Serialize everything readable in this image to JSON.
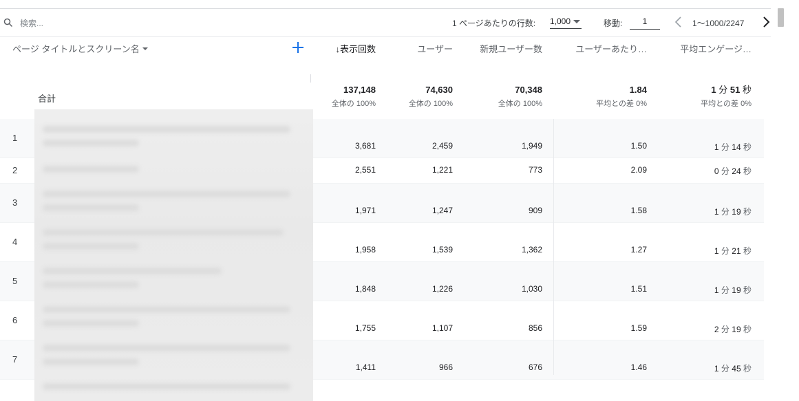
{
  "toolbar": {
    "search_placeholder": "検索...",
    "rows_per_page_label": "1 ページあたりの行数:",
    "rows_per_page_value": "1,000",
    "goto_label": "移動:",
    "goto_value": "1",
    "range": "1〜1000/2247"
  },
  "header": {
    "dimension": "ページ タイトルとスクリーン名",
    "metrics": [
      "↓表示回数",
      "ユーザー",
      "新規ユーザー数",
      "ユーザーあたり…",
      "平均エンゲージ…"
    ]
  },
  "totals": {
    "label": "合計",
    "views": "137,148",
    "views_sub": "全体の 100%",
    "users": "74,630",
    "users_sub": "全体の 100%",
    "new_users": "70,348",
    "new_users_sub": "全体の 100%",
    "per_user": "1.84",
    "per_user_sub": "平均との差 0%",
    "eng_min": "1",
    "eng_sec": "51",
    "min_unit": "分",
    "sec_unit": "秒",
    "eng_sub": "平均との差 0%"
  },
  "rows": [
    {
      "n": "1",
      "views": "3,681",
      "users": "2,459",
      "new_users": "1,949",
      "per_user": "1.50",
      "min": "1",
      "sec": "14"
    },
    {
      "n": "2",
      "views": "2,551",
      "users": "1,221",
      "new_users": "773",
      "per_user": "2.09",
      "min": "0",
      "sec": "24"
    },
    {
      "n": "3",
      "views": "1,971",
      "users": "1,247",
      "new_users": "909",
      "per_user": "1.58",
      "min": "1",
      "sec": "19"
    },
    {
      "n": "4",
      "views": "1,958",
      "users": "1,539",
      "new_users": "1,362",
      "per_user": "1.27",
      "min": "1",
      "sec": "21"
    },
    {
      "n": "5",
      "views": "1,848",
      "users": "1,226",
      "new_users": "1,030",
      "per_user": "1.51",
      "min": "1",
      "sec": "19"
    },
    {
      "n": "6",
      "views": "1,755",
      "users": "1,107",
      "new_users": "856",
      "per_user": "1.59",
      "min": "2",
      "sec": "19"
    },
    {
      "n": "7",
      "views": "1,411",
      "users": "966",
      "new_users": "676",
      "per_user": "1.46",
      "min": "1",
      "sec": "45"
    }
  ],
  "units": {
    "min": "分",
    "sec": "秒"
  },
  "colors": {
    "accent": "#1a73e8",
    "text": "#202124",
    "muted": "#5f6368"
  }
}
